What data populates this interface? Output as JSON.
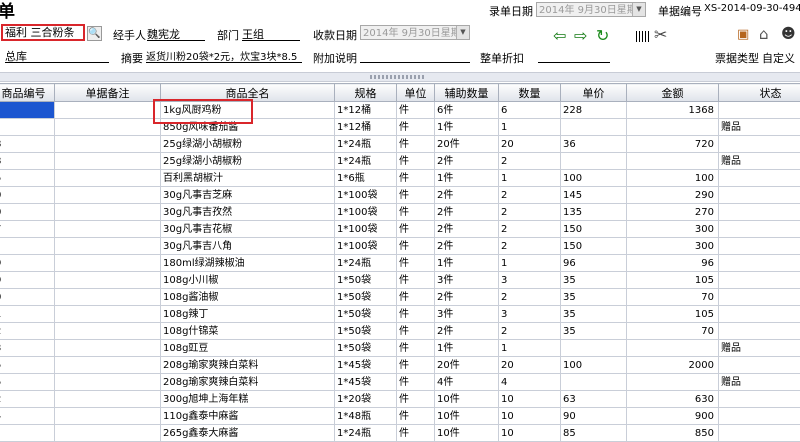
{
  "window_title": "单",
  "header": {
    "date_label": "录单日期",
    "date_value": "2014年 9月30日星期",
    "bill_no_label": "单据编号",
    "bill_no_value": "XS-2014-09-30-4946",
    "client_value": "福利 三合粉条",
    "handler_label": "经手人",
    "handler_value": "魏宪龙",
    "dept_label": "部门",
    "dept_value": "王组",
    "receive_date_label": "收款日期",
    "receive_date_value": "2014年 9月30日星期",
    "warehouse_value": "总库",
    "summary_label": "摘要",
    "summary_value": "返货川粉20袋*2元，炊宝3块*8.5",
    "attach_label": "附加说明",
    "discount_label": "整单折扣",
    "bill_type_label": "票据类型",
    "bill_type_value": "自定义"
  },
  "columns": [
    "商品编号",
    "单据备注",
    "商品全名",
    "规格",
    "单位",
    "辅助数量",
    "数量",
    "单价",
    "金额",
    "状态"
  ],
  "rows": [
    {
      "code": "",
      "note": "",
      "name": "1kg风厨鸡粉",
      "spec": "1*12桶",
      "unit": "件",
      "aux": "6件",
      "qty": "6",
      "price": "228",
      "amount": "1368",
      "status": ""
    },
    {
      "code": "",
      "note": "",
      "name": "850g风味番茄酱",
      "spec": "1*12桶",
      "unit": "件",
      "aux": "1件",
      "qty": "1",
      "price": "",
      "amount": "",
      "status": "赠品"
    },
    {
      "code": "8",
      "note": "",
      "name": "25g绿湖小胡椒粉",
      "spec": "1*24瓶",
      "unit": "件",
      "aux": "20件",
      "qty": "20",
      "price": "36",
      "amount": "720",
      "status": ""
    },
    {
      "code": "8",
      "note": "",
      "name": "25g绿湖小胡椒粉",
      "spec": "1*24瓶",
      "unit": "件",
      "aux": "2件",
      "qty": "2",
      "price": "",
      "amount": "",
      "status": "赠品"
    },
    {
      "code": "5",
      "note": "",
      "name": "百利黑胡椒汁",
      "spec": "1*6瓶",
      "unit": "件",
      "aux": "1件",
      "qty": "1",
      "price": "100",
      "amount": "100",
      "status": ""
    },
    {
      "code": "0",
      "note": "",
      "name": "30g凡事吉芝麻",
      "spec": "1*100袋",
      "unit": "件",
      "aux": "2件",
      "qty": "2",
      "price": "145",
      "amount": "290",
      "status": ""
    },
    {
      "code": "0",
      "note": "",
      "name": "30g凡事吉孜然",
      "spec": "1*100袋",
      "unit": "件",
      "aux": "2件",
      "qty": "2",
      "price": "135",
      "amount": "270",
      "status": ""
    },
    {
      "code": "7",
      "note": "",
      "name": "30g凡事吉花椒",
      "spec": "1*100袋",
      "unit": "件",
      "aux": "2件",
      "qty": "2",
      "price": "150",
      "amount": "300",
      "status": ""
    },
    {
      "code": "'",
      "note": "",
      "name": "30g凡事吉八角",
      "spec": "1*100袋",
      "unit": "件",
      "aux": "2件",
      "qty": "2",
      "price": "150",
      "amount": "300",
      "status": ""
    },
    {
      "code": "9",
      "note": "",
      "name": "180ml绿湖辣椒油",
      "spec": "1*24瓶",
      "unit": "件",
      "aux": "1件",
      "qty": "1",
      "price": "96",
      "amount": "96",
      "status": ""
    },
    {
      "code": "9",
      "note": "",
      "name": "108g小川椒",
      "spec": "1*50袋",
      "unit": "件",
      "aux": "3件",
      "qty": "3",
      "price": "35",
      "amount": "105",
      "status": ""
    },
    {
      "code": "0",
      "note": "",
      "name": "108g酱油椒",
      "spec": "1*50袋",
      "unit": "件",
      "aux": "2件",
      "qty": "2",
      "price": "35",
      "amount": "70",
      "status": ""
    },
    {
      "code": "1",
      "note": "",
      "name": "108g辣丁",
      "spec": "1*50袋",
      "unit": "件",
      "aux": "3件",
      "qty": "3",
      "price": "35",
      "amount": "105",
      "status": ""
    },
    {
      "code": "2",
      "note": "",
      "name": "108g什锦菜",
      "spec": "1*50袋",
      "unit": "件",
      "aux": "2件",
      "qty": "2",
      "price": "35",
      "amount": "70",
      "status": ""
    },
    {
      "code": "3",
      "note": "",
      "name": "108g豇豆",
      "spec": "1*50袋",
      "unit": "件",
      "aux": "1件",
      "qty": "1",
      "price": "",
      "amount": "",
      "status": "赠品"
    },
    {
      "code": "5",
      "note": "",
      "name": "208g瑜家爽辣白菜料",
      "spec": "1*45袋",
      "unit": "件",
      "aux": "20件",
      "qty": "20",
      "price": "100",
      "amount": "2000",
      "status": ""
    },
    {
      "code": "5",
      "note": "",
      "name": "208g瑜家爽辣白菜料",
      "spec": "1*45袋",
      "unit": "件",
      "aux": "4件",
      "qty": "4",
      "price": "",
      "amount": "",
      "status": "赠品"
    },
    {
      "code": "2",
      "note": "",
      "name": "300g旭坤上海年糕",
      "spec": "1*20袋",
      "unit": "件",
      "aux": "10件",
      "qty": "10",
      "price": "63",
      "amount": "630",
      "status": ""
    },
    {
      "code": "4",
      "note": "",
      "name": "110g鑫泰中麻酱",
      "spec": "1*48瓶",
      "unit": "件",
      "aux": "10件",
      "qty": "10",
      "price": "90",
      "amount": "900",
      "status": ""
    },
    {
      "code": "",
      "note": "",
      "name": "265g鑫泰大麻酱",
      "spec": "1*24瓶",
      "unit": "件",
      "aux": "10件",
      "qty": "10",
      "price": "85",
      "amount": "850",
      "status": ""
    }
  ],
  "colors": {
    "selection": "#1c56d0",
    "highlight": "#d9262b",
    "back_arrow": "#127a12",
    "refresh": "#1a8a1a"
  },
  "icons": [
    "search-icon",
    "back-arrow-icon",
    "forward-arrow-icon",
    "refresh-icon",
    "barcode-icon",
    "tools-icon",
    "bag-icon",
    "home-icon",
    "user-icon"
  ]
}
